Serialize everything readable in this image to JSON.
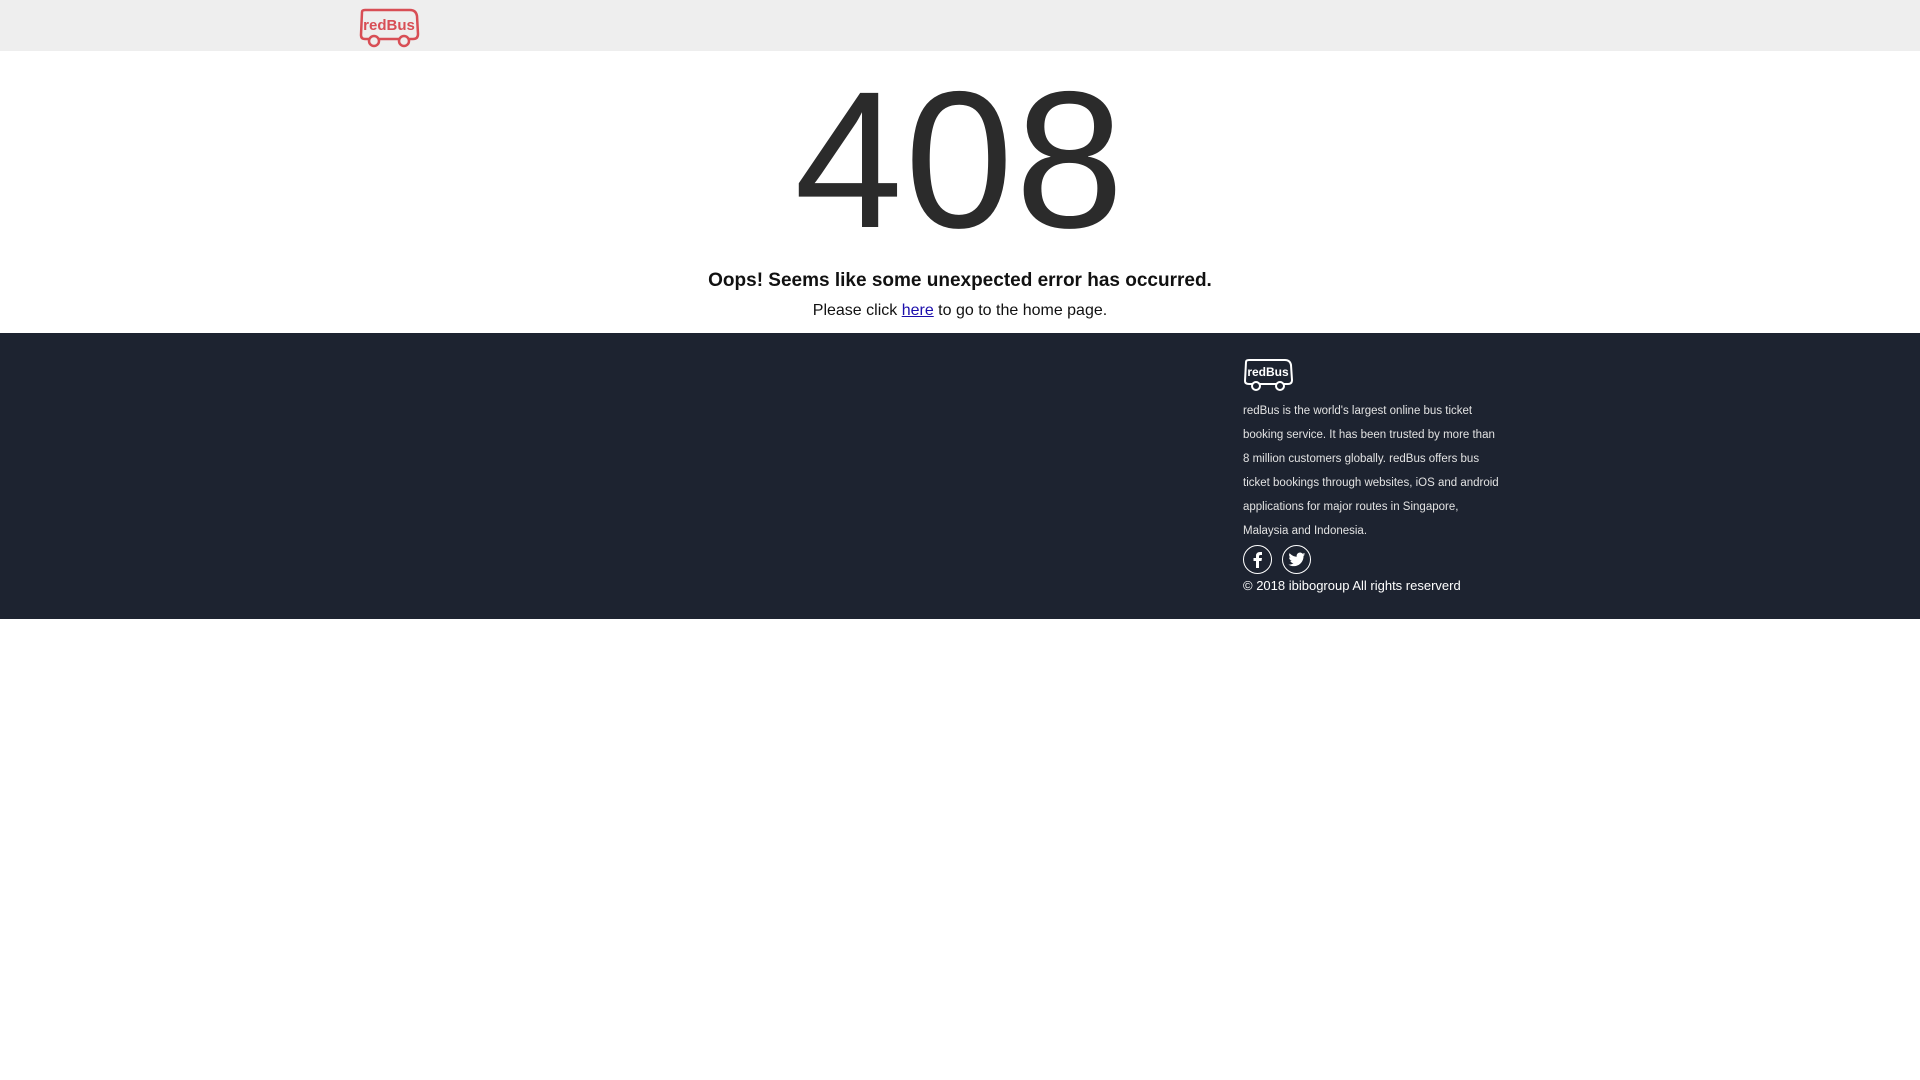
{
  "header": {
    "logo_text": "redBus",
    "brand_color": "#d84e55",
    "background": "#eeeeee"
  },
  "error": {
    "code": "408",
    "message": "Oops! Seems like some unexpected error has occurred.",
    "home_prefix": "Please click ",
    "home_link": "here",
    "home_suffix": " to go to the home page."
  },
  "footer": {
    "background": "#1d2330",
    "logo_text": "redBus",
    "description": "redBus is the world's largest online bus ticket booking service. It has been trusted by more than 8 million customers globally. redBus offers bus ticket bookings through websites, iOS and android applications for major routes in Singapore, Malaysia and Indonesia.",
    "social": [
      {
        "icon": "facebook-icon"
      },
      {
        "icon": "twitter-icon"
      }
    ],
    "copyright": "© 2018 ibibogroup All rights reserverd"
  }
}
